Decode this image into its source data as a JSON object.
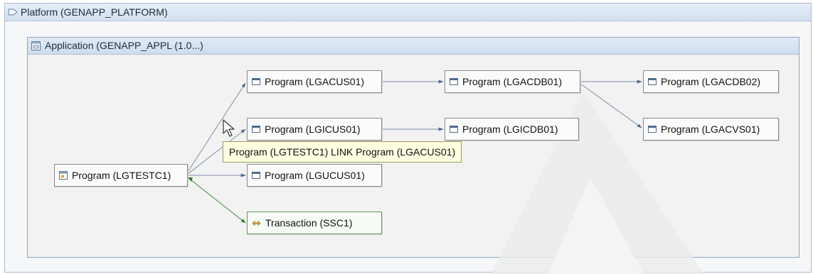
{
  "platform": {
    "title": "Platform (GENAPP_PLATFORM)"
  },
  "application": {
    "title": "Application (GENAPP_APPL (1.0...)"
  },
  "nodes": {
    "lgtestc1": "Program (LGTESTC1)",
    "lgacus01": "Program (LGACUS01)",
    "lgicus01": "Program (LGICUS01)",
    "lgucus01": "Program (LGUCUS01)",
    "ssc1": "Transaction (SSC1)",
    "lgacdb01": "Program (LGACDB01)",
    "lgicdb01": "Program (LGICDB01)",
    "lgacdb02": "Program (LGACDB02)",
    "lgacvs01": "Program (LGACVS01)"
  },
  "tooltip": {
    "text": "Program (LGTESTC1) LINK Program (LGACUS01)"
  },
  "colors": {
    "program_edge": "#6b7f99",
    "transaction_edge": "#3f8a3f",
    "header": "#d3e0ef"
  },
  "icons": {
    "platform": "platform-icon",
    "application": "application-icon",
    "program": "program-icon",
    "transaction": "transaction-icon",
    "cursor": "mouse-pointer-icon"
  }
}
